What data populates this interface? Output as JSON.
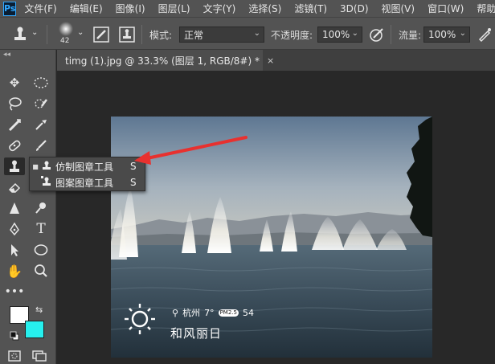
{
  "app": {
    "logo": "Ps"
  },
  "menu": [
    "文件(F)",
    "编辑(E)",
    "图像(I)",
    "图层(L)",
    "文字(Y)",
    "选择(S)",
    "滤镜(T)",
    "3D(D)",
    "视图(V)",
    "窗口(W)",
    "帮助(H)"
  ],
  "options": {
    "brush_size": "42",
    "mode_label": "模式:",
    "mode_value": "正常",
    "opacity_label": "不透明度:",
    "opacity_value": "100%",
    "flow_label": "流量:",
    "flow_value": "100%"
  },
  "document": {
    "tab_title": "timg (1).jpg @ 33.3% (图层 1, RGB/8#) *",
    "close_glyph": "×"
  },
  "flyout": [
    {
      "label": "仿制图章工具",
      "shortcut": "S",
      "selected": true
    },
    {
      "label": "图案图章工具",
      "shortcut": "S",
      "selected": false
    }
  ],
  "colors": {
    "foreground": "#ffffff",
    "background": "#26f0ee",
    "annotation_arrow": "#e8312f"
  },
  "watermark": {
    "location": "杭州",
    "temperature": "7°",
    "air_badge": "PM2.5",
    "air_value": "54",
    "condition": "和风丽日"
  }
}
